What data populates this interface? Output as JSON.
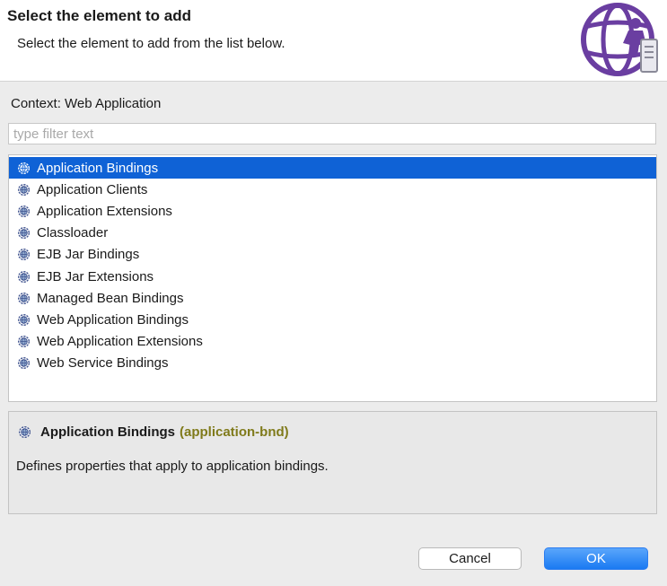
{
  "header": {
    "title": "Select the element to add",
    "subtitle": "Select the element to add from the list below."
  },
  "context_label": "Context: Web Application",
  "filter": {
    "placeholder": "type filter text",
    "value": ""
  },
  "elements": [
    {
      "label": "Application Bindings",
      "selected": true
    },
    {
      "label": "Application Clients",
      "selected": false
    },
    {
      "label": "Application Extensions",
      "selected": false
    },
    {
      "label": "Classloader",
      "selected": false
    },
    {
      "label": "EJB Jar Bindings",
      "selected": false
    },
    {
      "label": "EJB Jar Extensions",
      "selected": false
    },
    {
      "label": "Managed Bean Bindings",
      "selected": false
    },
    {
      "label": "Web Application Bindings",
      "selected": false
    },
    {
      "label": "Web Application Extensions",
      "selected": false
    },
    {
      "label": "Web Service Bindings",
      "selected": false
    }
  ],
  "details": {
    "name": "Application Bindings",
    "id": "(application-bnd)",
    "description": "Defines properties that apply to application bindings."
  },
  "buttons": {
    "cancel": "Cancel",
    "ok": "OK"
  },
  "icons": {
    "item": "gear-globe-icon",
    "wizard": "wizard-globe-icon"
  },
  "colors": {
    "selection": "#0f62d6",
    "element_id": "#7f7a1a",
    "ok_button": "#1a7af2",
    "wizard_accent": "#6a3ea1"
  }
}
